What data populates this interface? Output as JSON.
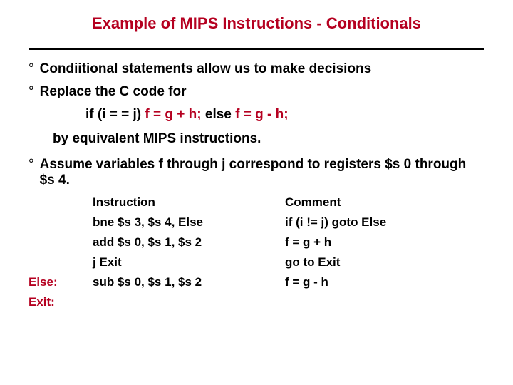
{
  "title": "Example of MIPS Instructions - Conditionals",
  "bullets": {
    "b1": "Condiitional statements allow us to make decisions",
    "b2": "Replace the C code for",
    "b3": "Assume variables f through j correspond to registers $s 0 through $s 4."
  },
  "code": {
    "if_cond": "if (i = = j) ",
    "then_part": "f = g + h;",
    "mid": " else ",
    "else_part": "f = g  - h;"
  },
  "sub_line": "by equivalent MIPS instructions.",
  "table": {
    "header_instr": "Instruction",
    "header_comment": "Comment",
    "rows": [
      {
        "label": "",
        "instr": "bne $s 3, $s 4, Else",
        "comment": "if (i != j) goto Else"
      },
      {
        "label": "",
        "instr": "add $s 0, $s 1, $s 2",
        "comment": "f = g + h"
      },
      {
        "label": "",
        "instr": "j Exit",
        "comment": "go to Exit"
      },
      {
        "label": "Else:",
        "instr": "sub $s 0, $s 1, $s 2",
        "comment": "f = g - h"
      },
      {
        "label": "Exit:",
        "instr": "",
        "comment": ""
      }
    ]
  }
}
